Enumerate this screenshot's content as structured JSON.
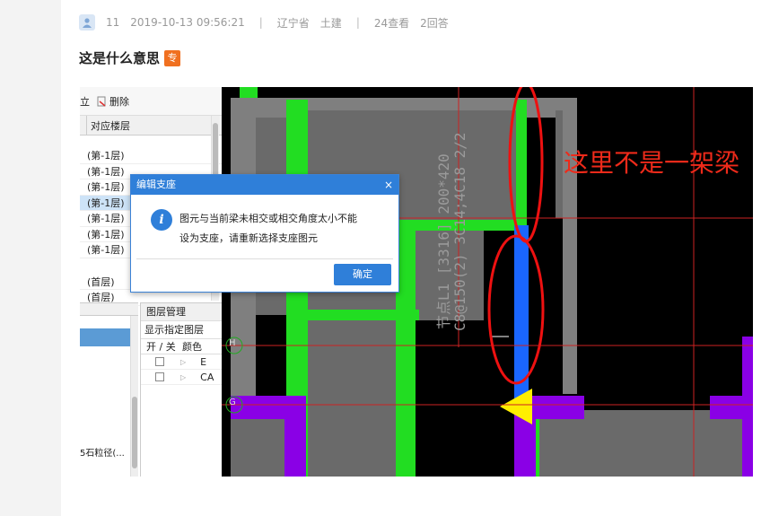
{
  "meta": {
    "user": "11",
    "datetime": "2019-10-13 09:56:21",
    "province": "辽宁省",
    "category": "土建",
    "views": "24查看",
    "answers": "2回答"
  },
  "question": {
    "title": "这是什么意思",
    "badge": "专"
  },
  "panel": {
    "toolbar_left": "立",
    "toolbar_delete": "删除",
    "col_header": "对应楼层",
    "rows": [
      "(第-1层)",
      "(第-1层)",
      "(第-1层)",
      "(第-1层)",
      "(第-1层)",
      "(第-1层)",
      "(第-1层)"
    ],
    "rows2": [
      "(首层)",
      "(首层)"
    ],
    "bottom_left_text": "5石粒径(...",
    "layer": {
      "title": "图层管理",
      "show": "显示指定图层",
      "col_toggle": "开 / 关",
      "col_color": "颜色",
      "row1_tail": "E",
      "row2_tail": "CA"
    }
  },
  "dialog": {
    "title": "编辑支座",
    "message_line1": "图元与当前梁未相交或相交角度太小不能",
    "message_line2": "设为支座，请重新选择支座图元",
    "ok": "确定"
  },
  "cad": {
    "text_line1": "节点L1 [3316] 200*420",
    "text_line2": "C8@150(2) 3C14;4C18 2/2",
    "axis_h": "H",
    "axis_g": "G"
  },
  "annotation": "这里不是一架梁"
}
